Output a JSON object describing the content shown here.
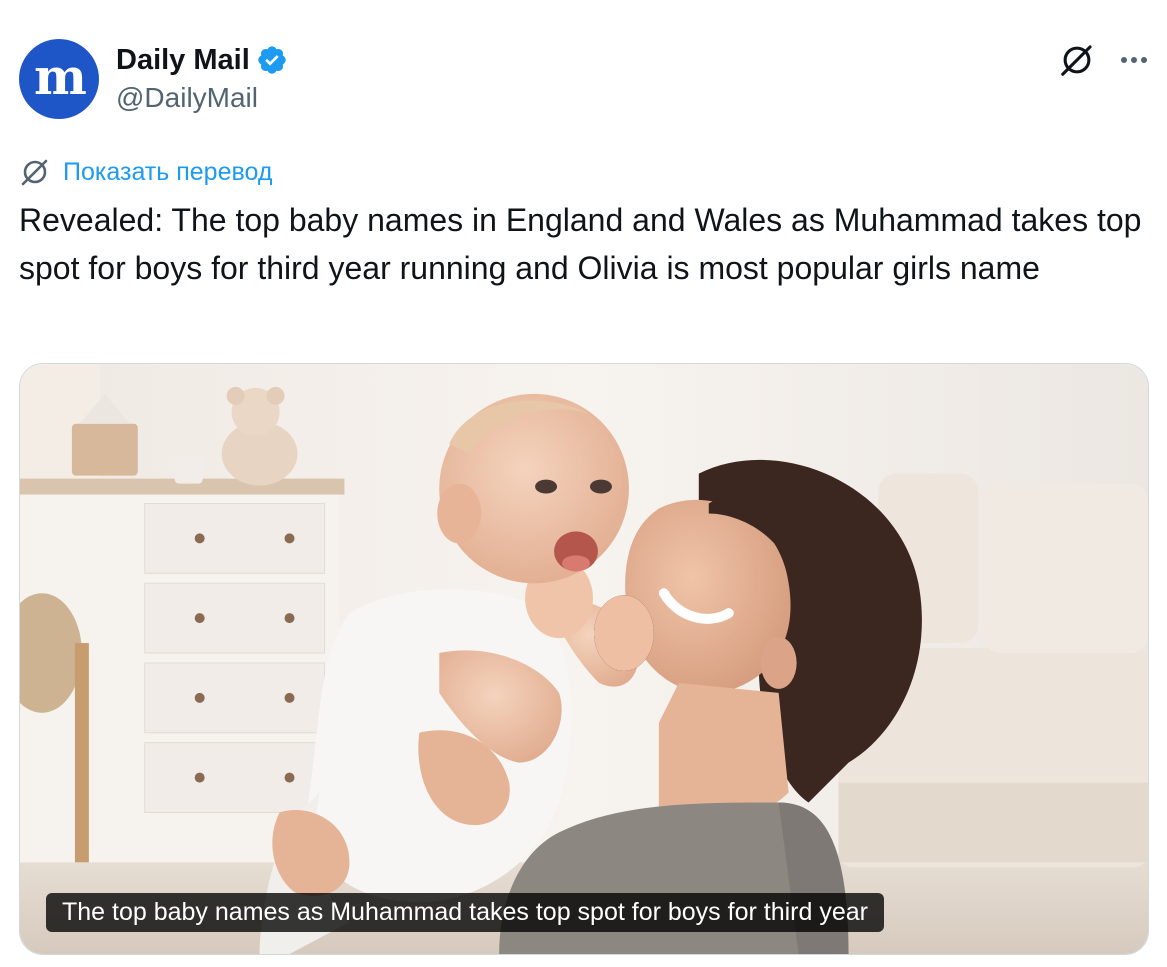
{
  "account": {
    "display_name": "Daily Mail",
    "handle": "@DailyMail",
    "avatar_letter": "m",
    "avatar_color": "#1e56c8",
    "verified": true,
    "verified_color": "#1d9bf0"
  },
  "header_actions": {
    "grok_icon": "grok-icon",
    "more_icon": "more-options-icon"
  },
  "translate": {
    "label": "Показать перевод",
    "icon": "grok-icon",
    "color": "#1d9bf0"
  },
  "tweet": {
    "text": "Revealed: The top baby names in England and Wales as Muhammad takes top spot for boys for third year running and Olivia is most popular girls name"
  },
  "media": {
    "type": "photo",
    "caption": "The top baby names as Muhammad takes top spot for boys for third year"
  }
}
